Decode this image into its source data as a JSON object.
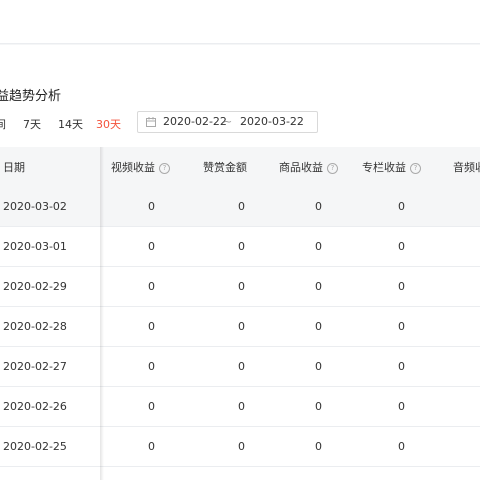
{
  "section_title": "益趋势分析",
  "range_tabs": [
    {
      "label": "间",
      "active": false
    },
    {
      "label": "7天",
      "active": false
    },
    {
      "label": "14天",
      "active": false
    },
    {
      "label": "30天",
      "active": true
    }
  ],
  "date_range": {
    "start": "2020-02-22",
    "separator": "~",
    "end": "2020-03-22"
  },
  "table": {
    "headers": {
      "date": "日期",
      "video": "视频收益",
      "tips": "赞赏金额",
      "goods": "商品收益",
      "column": "专栏收益",
      "audio": "音频收"
    },
    "rows": [
      {
        "date": "2020-03-02",
        "video": "0",
        "tips": "0",
        "goods": "0",
        "column": "0"
      },
      {
        "date": "2020-03-01",
        "video": "0",
        "tips": "0",
        "goods": "0",
        "column": "0"
      },
      {
        "date": "2020-02-29",
        "video": "0",
        "tips": "0",
        "goods": "0",
        "column": "0"
      },
      {
        "date": "2020-02-28",
        "video": "0",
        "tips": "0",
        "goods": "0",
        "column": "0"
      },
      {
        "date": "2020-02-27",
        "video": "0",
        "tips": "0",
        "goods": "0",
        "column": "0"
      },
      {
        "date": "2020-02-26",
        "video": "0",
        "tips": "0",
        "goods": "0",
        "column": "0"
      },
      {
        "date": "2020-02-25",
        "video": "0",
        "tips": "0",
        "goods": "0",
        "column": "0"
      }
    ]
  },
  "colors": {
    "accent": "#f4523b",
    "header_bg": "#f5f6f7",
    "border": "#ebedf0"
  }
}
